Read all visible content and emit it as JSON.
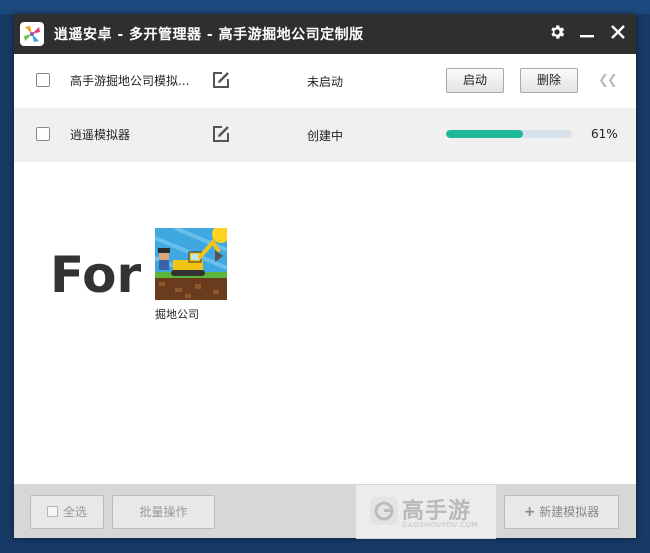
{
  "window": {
    "title": "逍遥安卓 - 多开管理器 - 高手游掘地公司定制版"
  },
  "rows": [
    {
      "name": "高手游掘地公司模拟...",
      "status": "未启动",
      "start_label": "启动",
      "delete_label": "删除"
    },
    {
      "name": "逍遥模拟器",
      "status": "创建中",
      "progress": 61,
      "progress_text": "61%"
    }
  ],
  "promo": {
    "for_text": "For",
    "game_name": "掘地公司"
  },
  "bottom": {
    "select_all_label": "全选",
    "batch_label": "批量操作",
    "new_label": "新建模拟器"
  },
  "watermark": {
    "main": "高手游",
    "sub": "GAOSHOUYOU.COM"
  },
  "colors": {
    "titlebar": "#2f2f2f",
    "progress": "#1fb99a",
    "bottombar": "#d7d7d7"
  },
  "icons": {
    "settings": "gear-icon",
    "minimize": "minimize-icon",
    "close": "close-icon",
    "edit": "edit-icon",
    "collapse": "double-chevron-left-icon",
    "plus": "plus-icon"
  }
}
